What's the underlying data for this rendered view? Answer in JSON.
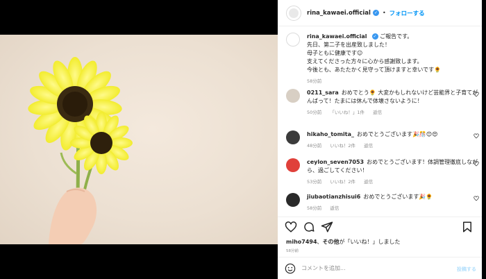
{
  "post": {
    "username": "rina_kawaei.official",
    "follow_label": "フォローする",
    "separator": "•"
  },
  "caption": {
    "username": "rina_kawaei.official",
    "lines": [
      "ご報告です。",
      "先日、第二子を出産致しました！",
      "母子ともに健康です☺︎",
      "支えてくださった方々に心から感謝致します。",
      "今後とも、あたたかく見守って頂けますと幸いです🌻"
    ],
    "time": "58分前"
  },
  "comments": [
    {
      "username": "0211_sara",
      "text": "おめでとう🌻 大変かもしれないけど芸能界と子育てがんばって！たまには休んで体壊さないように！",
      "time": "50分前",
      "likes": "「いいね！」1件",
      "reply": "返信"
    },
    {
      "username": "hikaho_tomita_",
      "text": "おめでとうございます🎉🎊😊😍",
      "time": "48分前",
      "likes": "いいね！2件",
      "reply": "返信"
    },
    {
      "username": "ceylon_seven7053",
      "text": "おめでとうございます！体調管理徹底しながら、過ごしてください！",
      "time": "53分前",
      "likes": "いいね！2件",
      "reply": "返信"
    },
    {
      "username": "jiubaotianzhisui6",
      "text": "おめでとうございます🎉🌻",
      "time": "58分前",
      "likes": "",
      "reply": "返信"
    }
  ],
  "likes_line": {
    "user": "miho7494",
    "mid": "、",
    "others": "その他",
    "rest": "が「いいね！」しました"
  },
  "post_time": "58分前",
  "composer": {
    "placeholder": "コメントを追加...",
    "post_label": "投稿する"
  },
  "icons": [
    "heart-icon",
    "comment-icon",
    "share-icon",
    "bookmark-icon",
    "emoji-icon",
    "verified-icon"
  ],
  "colors": {
    "accent": "#0095f6",
    "verified": "#3897f0",
    "muted": "#8e8e8e"
  }
}
